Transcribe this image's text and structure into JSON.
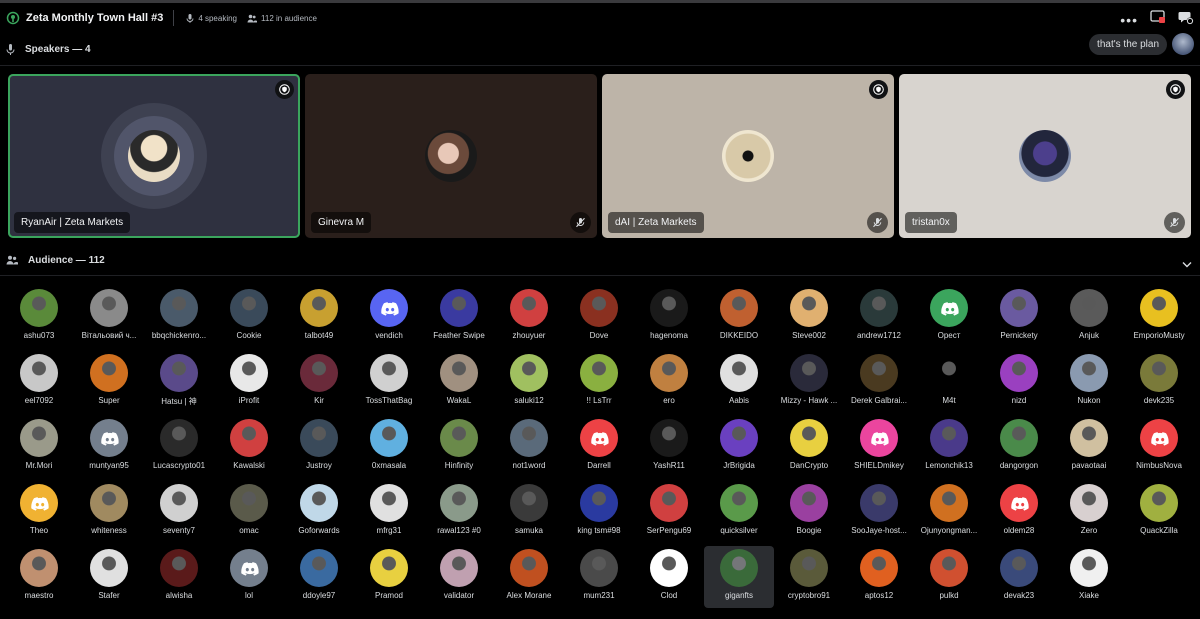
{
  "header": {
    "title": "Zeta Monthly Town Hall #3",
    "speaking": "4 speaking",
    "audience": "112 in audience"
  },
  "speakers_section": {
    "label": "Speakers — 4",
    "chip": "that's the plan"
  },
  "speakers": [
    {
      "name": "RyanAir | Zeta Markets",
      "highlight": "#3ba55d",
      "muted": false,
      "badge": true
    },
    {
      "name": "Ginevra M",
      "muted": true,
      "badge": false
    },
    {
      "name": "dAI | Zeta Markets",
      "muted": true,
      "badge": true
    },
    {
      "name": "tristan0x",
      "muted": true,
      "badge": true
    }
  ],
  "audience_section": {
    "label": "Audience — 112"
  },
  "audience": [
    {
      "name": "ashu073",
      "color": "#5a8a3a"
    },
    {
      "name": "Вітальовий ч...",
      "color": "#8a8a8a"
    },
    {
      "name": "bbqchickenro...",
      "color": "#4a5a6a"
    },
    {
      "name": "Cookie",
      "color": "#3a4a5a"
    },
    {
      "name": "talbot49",
      "color": "#c8a030"
    },
    {
      "name": "vendich",
      "color": "#5865f2",
      "discord": true
    },
    {
      "name": "Feather Swipe",
      "color": "#3a3aa0"
    },
    {
      "name": "zhouyuer",
      "color": "#d04040"
    },
    {
      "name": "Dove",
      "color": "#8a3020"
    },
    {
      "name": "hagenoma",
      "color": "#1a1a1a"
    },
    {
      "name": "DIKKEIDO",
      "color": "#c06030"
    },
    {
      "name": "Steve002",
      "color": "#e0b070"
    },
    {
      "name": "andrew1712",
      "color": "#2a3a3a"
    },
    {
      "name": "Орест",
      "color": "#3ba55d",
      "discord": true
    },
    {
      "name": "Pernickety",
      "color": "#6a5aa0"
    },
    {
      "name": "Anjuk",
      "color": "#5a5a5a"
    },
    {
      "name": "EmporioMusty",
      "color": "#e8c020"
    },
    {
      "name": "eel7092",
      "color": "#c8c8c8"
    },
    {
      "name": "Super",
      "color": "#d07020"
    },
    {
      "name": "Hatsu | 神",
      "color": "#5a4a8a"
    },
    {
      "name": "iProfit",
      "color": "#e8e8e8"
    },
    {
      "name": "Kir",
      "color": "#6a2a3a"
    },
    {
      "name": "TossThatBag",
      "color": "#d0d0d0"
    },
    {
      "name": "WakaL",
      "color": "#a09080"
    },
    {
      "name": "saluki12",
      "color": "#a0c060"
    },
    {
      "name": "!! LsTrr",
      "color": "#8ab040"
    },
    {
      "name": "ero",
      "color": "#c08040"
    },
    {
      "name": "Aabis",
      "color": "#e0e0e0"
    },
    {
      "name": "Mizzy - Hawk ...",
      "color": "#2a2a3a"
    },
    {
      "name": "Derek Galbrai...",
      "color": "#4a3a20"
    },
    {
      "name": "M4t",
      "color": "#000000"
    },
    {
      "name": "nizd",
      "color": "#9a40c0"
    },
    {
      "name": "Nukon",
      "color": "#8a9ab0"
    },
    {
      "name": "devk235",
      "color": "#7a7a3a"
    },
    {
      "name": "Mr.Mori",
      "color": "#9a9a8a"
    },
    {
      "name": "muntyan95",
      "color": "#747f8d",
      "discord": true
    },
    {
      "name": "Lucascrypto01",
      "color": "#2a2a2a"
    },
    {
      "name": "Kawalski",
      "color": "#d04040"
    },
    {
      "name": "Justroy",
      "color": "#3a4a5a"
    },
    {
      "name": "0xmasala",
      "color": "#60b0e0"
    },
    {
      "name": "Hinfinity",
      "color": "#6a8a4a"
    },
    {
      "name": "not1word",
      "color": "#5a6a7a"
    },
    {
      "name": "Darrell",
      "color": "#ed4245",
      "discord": true
    },
    {
      "name": "YashR11",
      "color": "#1a1a1a"
    },
    {
      "name": "JrBrigida",
      "color": "#6a40c0"
    },
    {
      "name": "DanCrypto",
      "color": "#e8d040"
    },
    {
      "name": "SHIELDmikey",
      "color": "#eb459e",
      "discord": true
    },
    {
      "name": "Lemonchik13",
      "color": "#4a3a8a"
    },
    {
      "name": "dangorgon",
      "color": "#4a8a4a"
    },
    {
      "name": "pavaotaai",
      "color": "#d0c0a0"
    },
    {
      "name": "NimbusNova",
      "color": "#ed4245",
      "discord": true
    },
    {
      "name": "Theo",
      "color": "#f0b232",
      "discord": true
    },
    {
      "name": "whiteness",
      "color": "#a08a60"
    },
    {
      "name": "seventy7",
      "color": "#d0d0d0"
    },
    {
      "name": "omac",
      "color": "#5a5a4a"
    },
    {
      "name": "Goforwards",
      "color": "#c0d8e8"
    },
    {
      "name": "mfrg31",
      "color": "#e0e0e0"
    },
    {
      "name": "rawal123 #0",
      "color": "#8a9a8a"
    },
    {
      "name": "samuka",
      "color": "#3a3a3a"
    },
    {
      "name": "king tsm#98",
      "color": "#2a3aa0"
    },
    {
      "name": "SerPengu69",
      "color": "#d04040"
    },
    {
      "name": "quicksilver",
      "color": "#5a9a4a"
    },
    {
      "name": "Boogie",
      "color": "#9a40a0"
    },
    {
      "name": "SooJaye-host...",
      "color": "#3a3a6a"
    },
    {
      "name": "Ojunyongman...",
      "color": "#d07020"
    },
    {
      "name": "oldem28",
      "color": "#ed4245",
      "discord": true
    },
    {
      "name": "Zero",
      "color": "#d8d0d0"
    },
    {
      "name": "QuackZilla",
      "color": "#a0b040"
    },
    {
      "name": "maestro",
      "color": "#c09070"
    },
    {
      "name": "Stafer",
      "color": "#e0e0e0"
    },
    {
      "name": "alwisha",
      "color": "#5a1a1a"
    },
    {
      "name": "lol",
      "color": "#747f8d",
      "discord": true
    },
    {
      "name": "ddoyle97",
      "color": "#3a6aa0"
    },
    {
      "name": "Pramod",
      "color": "#e8d040"
    },
    {
      "name": "validator",
      "color": "#c0a0b0"
    },
    {
      "name": "Alex Morane",
      "color": "#c05020"
    },
    {
      "name": "mum231",
      "color": "#4a4a4a"
    },
    {
      "name": "Clod",
      "color": "#ffffff"
    },
    {
      "name": "giganfts",
      "color": "#3a6a3a",
      "highlight": true
    },
    {
      "name": "cryptobro91",
      "color": "#5a5a3a"
    },
    {
      "name": "aptos12",
      "color": "#e06020"
    },
    {
      "name": "pulkd",
      "color": "#d05030"
    },
    {
      "name": "devak23",
      "color": "#3a4a7a"
    },
    {
      "name": "Xiake",
      "color": "#f0f0f0"
    }
  ]
}
